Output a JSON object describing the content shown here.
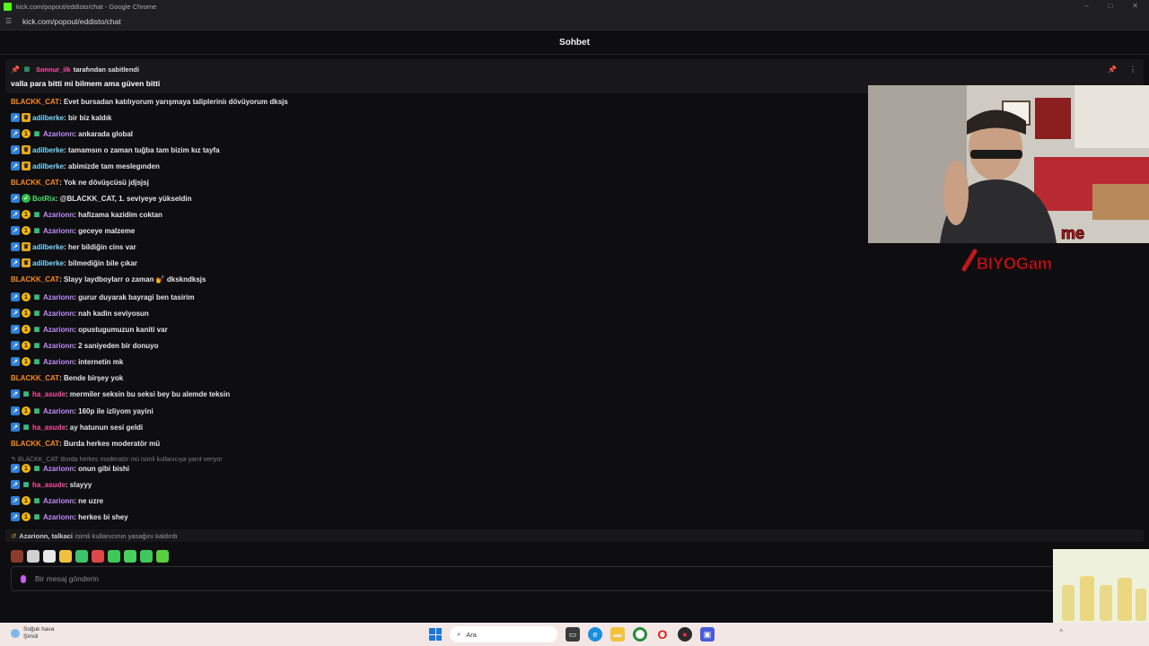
{
  "browser": {
    "title": "kick.com/popout/eddisto/chat - Google Chrome",
    "url": "kick.com/popout/eddisto/chat",
    "controls": [
      "–",
      "□",
      "✕"
    ]
  },
  "header": {
    "title": "Sohbet"
  },
  "pinned": {
    "pinned_by_user": "Sonnur_ilk",
    "pinned_by_suffix": "tarafından sabitlendi",
    "message": "valla para bitti mi bilmem ama güven bitti"
  },
  "chat": {
    "messages": [
      {
        "user": "BLACKK_CAT",
        "color": "#ff8a1c",
        "badges": [],
        "text": ": Evet bursadan katılıyorum yarışmaya talipleriniı dövüyorum dksjs"
      },
      {
        "user": "adilberke",
        "color": "#7fd8ff",
        "badges": [
          "mod",
          "og"
        ],
        "text": ": bir biz kaldık"
      },
      {
        "user": "Azarionn",
        "color": "#c18cff",
        "badges": [
          "mod",
          "sub",
          "gift"
        ],
        "text": ": ankarada global"
      },
      {
        "user": "adilberke",
        "color": "#7fd8ff",
        "badges": [
          "mod",
          "og"
        ],
        "text": ": tamamsın o zaman tuğba tam bizim kız tayfa"
      },
      {
        "user": "adilberke",
        "color": "#7fd8ff",
        "badges": [
          "mod",
          "og"
        ],
        "text": ": abimizde tam meslegınden"
      },
      {
        "user": "BLACKK_CAT",
        "color": "#ff8a1c",
        "badges": [],
        "text": ": Yok ne dövüşcüsü jdjsjsj"
      },
      {
        "user": "BotRix",
        "color": "#46e06a",
        "badges": [
          "mod",
          "vip"
        ],
        "text": ": @BLACKK_CAT, 1. seviyeye yükseldin"
      },
      {
        "user": "Azarionn",
        "color": "#c18cff",
        "badges": [
          "mod",
          "sub",
          "gift"
        ],
        "text": ": hafizama kazidim coktan"
      },
      {
        "user": "Azarionn",
        "color": "#c18cff",
        "badges": [
          "mod",
          "sub",
          "gift"
        ],
        "text": ": geceye malzeme"
      },
      {
        "user": "adilberke",
        "color": "#7fd8ff",
        "badges": [
          "mod",
          "og"
        ],
        "text": ": her bildiğin cins var"
      },
      {
        "user": "adilberke",
        "color": "#7fd8ff",
        "badges": [
          "mod",
          "og"
        ],
        "text": ": bilmediğin bile çıkar"
      },
      {
        "user": "BLACKK_CAT",
        "color": "#ff8a1c",
        "badges": [],
        "text": ": Slayy laydboylarr o zaman 💅 dkskndksjs"
      },
      {
        "user": "Azarionn",
        "color": "#c18cff",
        "badges": [
          "mod",
          "sub",
          "gift"
        ],
        "text": ": gurur duyarak bayragi ben tasirim"
      },
      {
        "user": "Azarionn",
        "color": "#c18cff",
        "badges": [
          "mod",
          "sub",
          "gift"
        ],
        "text": ": nah kadin seviyosun"
      },
      {
        "user": "Azarionn",
        "color": "#c18cff",
        "badges": [
          "mod",
          "sub",
          "gift"
        ],
        "text": ": opustugumuzun kaniti var"
      },
      {
        "user": "Azarionn",
        "color": "#c18cff",
        "badges": [
          "mod",
          "sub",
          "gift"
        ],
        "text": ": 2 saniyeden bir donuyo"
      },
      {
        "user": "Azarionn",
        "color": "#c18cff",
        "badges": [
          "mod",
          "sub",
          "gift"
        ],
        "text": ": internetin mk"
      },
      {
        "user": "BLACKK_CAT",
        "color": "#ff8a1c",
        "badges": [],
        "text": ": Bende birşey yok"
      },
      {
        "user": "ha_asude",
        "color": "#ff4da6",
        "badges": [
          "mod",
          "gift2"
        ],
        "text": ": mermiler seksin bu seksi bey bu alemde teksin"
      },
      {
        "user": "Azarionn",
        "color": "#c18cff",
        "badges": [
          "mod",
          "sub",
          "gift"
        ],
        "text": ": 160p ile izliyom yayini"
      },
      {
        "user": "ha_asude",
        "color": "#ff4da6",
        "badges": [
          "mod",
          "gift2"
        ],
        "text": ": ay hatunun sesi geldi"
      },
      {
        "user": "BLACKK_CAT",
        "color": "#ff8a1c",
        "badges": [],
        "text": ": Burda herkes moderatör mü"
      },
      {
        "user": "Azarionn",
        "color": "#c18cff",
        "badges": [
          "mod",
          "sub",
          "gift"
        ],
        "text": ": onun gibi bishi"
      },
      {
        "user": "ha_asude",
        "color": "#ff4da6",
        "badges": [
          "mod",
          "gift2"
        ],
        "text": ": slayyy"
      },
      {
        "user": "Azarionn",
        "color": "#c18cff",
        "badges": [
          "mod",
          "sub",
          "gift"
        ],
        "text": ": ne uzre"
      },
      {
        "user": "Azarionn",
        "color": "#c18cff",
        "badges": [
          "mod",
          "sub",
          "gift"
        ],
        "text": ": herkes bi shey"
      }
    ],
    "reply_ref": "BLACKK_CAT: Burda herkes moderatör mü isimli kullanıcıya yanıt veriyor"
  },
  "system": {
    "names": "Azarionn, talkaci",
    "text": "isimli kullanıcının yasağını kaldırdı"
  },
  "emotes": [
    "#8a3b2a",
    "#d0d0d0",
    "#e8e8e8",
    "#f0c040",
    "#39c46a",
    "#e04848",
    "#3fc85a",
    "#48d060",
    "#3fc85a",
    "#58d040"
  ],
  "input": {
    "placeholder": "Bir mesaj gönderin",
    "value": ""
  },
  "overlay": {
    "logo_text": "BIYOGam",
    "logo_sub": "me"
  },
  "taskbar": {
    "weather_title": "Soğuk hava",
    "weather_sub": "Şimdi",
    "search_placeholder": "Ara"
  }
}
